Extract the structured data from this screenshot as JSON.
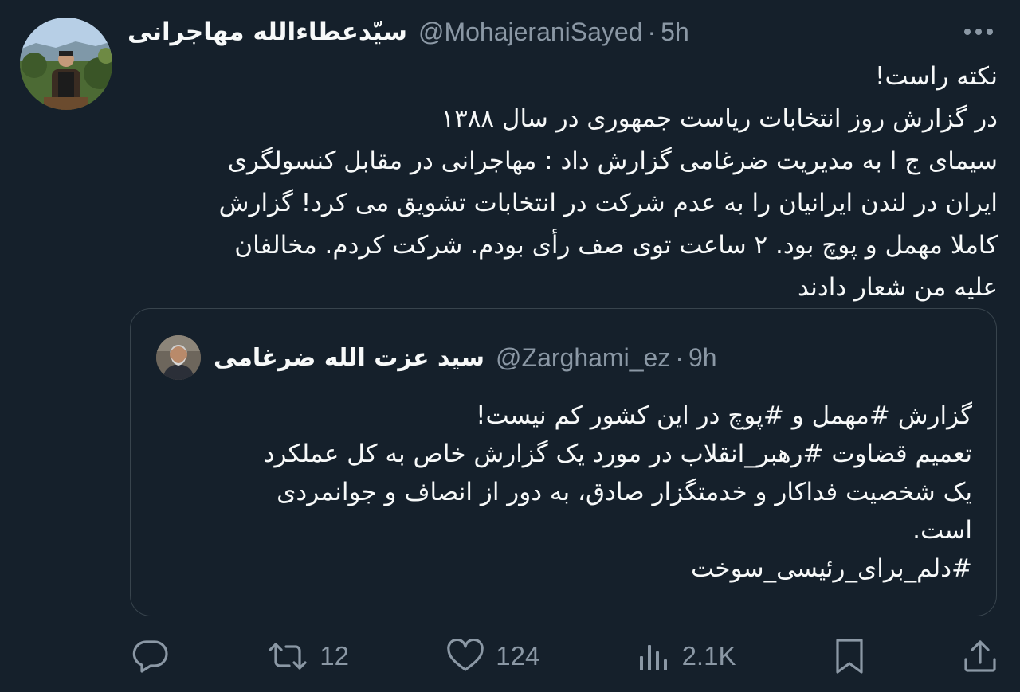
{
  "tweet": {
    "author": {
      "display_name": "سیّدعطاءالله مهاجرانی",
      "handle": "@MohajeraniSayed",
      "separator": "·",
      "time": "5h"
    },
    "text_lines": [
      "نکته راست!",
      "در گزارش روز انتخابات ریاست جمهوری در سال ۱۳۸۸",
      "سیمای ج ا به مدیریت ضرغامی گزارش داد : مهاجرانی در مقابل کنسولگری",
      "ایران در لندن ایرانیان را به عدم شرکت در انتخابات تشویق می کرد! گزارش",
      "کاملا مهمل و پوچ بود. ۲ ساعت توی صف رأی بودم. شرکت کردم. مخالفان",
      "علیه من شعار دادند"
    ]
  },
  "quote": {
    "author": {
      "display_name": "سید عزت الله ضرغامی",
      "handle": "@Zarghami_ez",
      "separator": "·",
      "time": "9h"
    },
    "text_lines": [
      "گزارش #مهمل و #پوچ در این کشور کم نیست!",
      "تعمیم قضاوت #رهبر_انقلاب در مورد یک گزارش خاص به کل عملکرد",
      "یک شخصیت فداکار و خدمتگزار صادق، به دور از انصاف و جوانمردی",
      "است.",
      "#دلم_برای_رئیسی_سوخت"
    ]
  },
  "actions": {
    "reply": {
      "icon": "reply-icon",
      "count": ""
    },
    "retweet": {
      "icon": "retweet-icon",
      "count": "12"
    },
    "like": {
      "icon": "heart-icon",
      "count": "124"
    },
    "views": {
      "icon": "views-icon",
      "count": "2.1K"
    },
    "bookmark": {
      "icon": "bookmark-icon"
    },
    "share": {
      "icon": "share-icon"
    }
  },
  "colors": {
    "background": "#15202b",
    "text": "#f7f9f9",
    "secondary": "#8b98a5",
    "border": "#38444d"
  }
}
